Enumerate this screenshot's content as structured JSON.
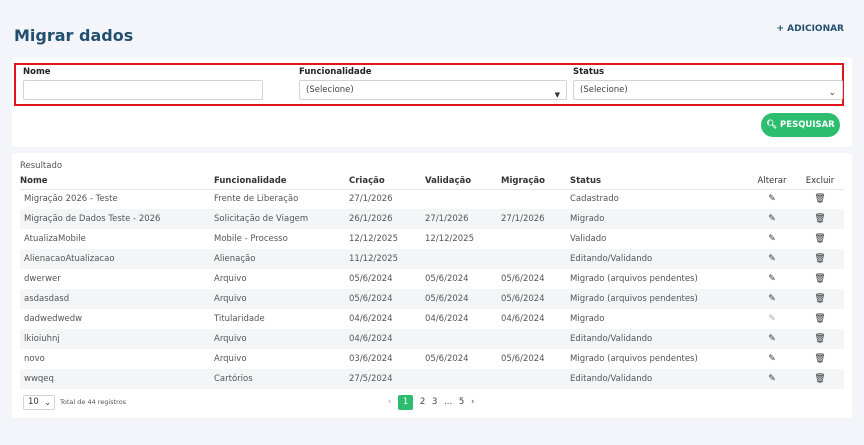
{
  "page": {
    "title": "Migrar dados",
    "add_label": "+ ADICIONAR"
  },
  "filters": {
    "nome": {
      "label": "Nome",
      "value": ""
    },
    "funcionalidade": {
      "label": "Funcionalidade",
      "value": "(Selecione)"
    },
    "status": {
      "label": "Status",
      "value": "(Selecione)"
    },
    "search_label": "PESQUISAR"
  },
  "results": {
    "label": "Resultado",
    "columns": [
      "Nome",
      "Funcionalidade",
      "Criação",
      "Validação",
      "Migração",
      "Status",
      "Alterar",
      "Excluir"
    ],
    "rows": [
      [
        "Migração 2026 - Teste",
        "Frente de Liberação",
        "27/1/2026",
        "",
        "",
        "Cadastrado"
      ],
      [
        "Migração de Dados Teste - 2026",
        "Solicitação de Viagem",
        "26/1/2026",
        "27/1/2026",
        "27/1/2026",
        "Migrado"
      ],
      [
        "AtualizaMobile",
        "Mobile - Processo",
        "12/12/2025",
        "12/12/2025",
        "",
        "Validado"
      ],
      [
        "AlienacaoAtualizacao",
        "Alienação",
        "11/12/2025",
        "",
        "",
        "Editando/Validando"
      ],
      [
        "dwerwer",
        "Arquivo",
        "05/6/2024",
        "05/6/2024",
        "05/6/2024",
        "Migrado (arquivos pendentes)"
      ],
      [
        "asdasdasd",
        "Arquivo",
        "05/6/2024",
        "05/6/2024",
        "05/6/2024",
        "Migrado (arquivos pendentes)"
      ],
      [
        "dadwedwedw",
        "Titularidade",
        "04/6/2024",
        "04/6/2024",
        "04/6/2024",
        "Migrado"
      ],
      [
        "lkioiuhnj",
        "Arquivo",
        "04/6/2024",
        "",
        "",
        "Editando/Validando"
      ],
      [
        "novo",
        "Arquivo",
        "03/6/2024",
        "05/6/2024",
        "05/6/2024",
        "Migrado (arquivos pendentes)"
      ],
      [
        "wwqeq",
        "Cartórios",
        "27/5/2024",
        "",
        "",
        "Editando/Validando"
      ]
    ]
  },
  "pagination": {
    "page_size": "10",
    "total_text": "Total de 44 registros",
    "pages": [
      "1",
      "2",
      "3",
      "...",
      "5"
    ],
    "current": "1"
  },
  "colors": {
    "accent": "#2dbd6e",
    "title": "#22506e",
    "highlight": "#e0161c"
  },
  "icons": {
    "edit": "edit-icon",
    "delete": "trash-icon"
  }
}
